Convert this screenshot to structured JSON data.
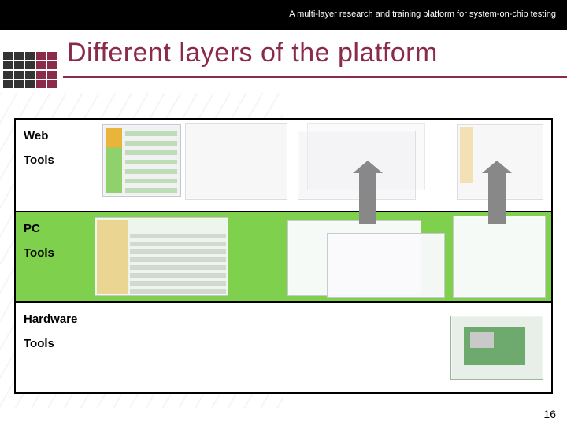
{
  "header": {
    "subtitle": "A multi-layer research and training platform for system-on-chip testing"
  },
  "title": "Different layers of the platform",
  "layers": [
    {
      "heading": "Web",
      "sub": "Tools"
    },
    {
      "heading": "PC",
      "sub": "Tools"
    },
    {
      "heading": "Hardware",
      "sub": "Tools"
    }
  ],
  "page_number": "16"
}
